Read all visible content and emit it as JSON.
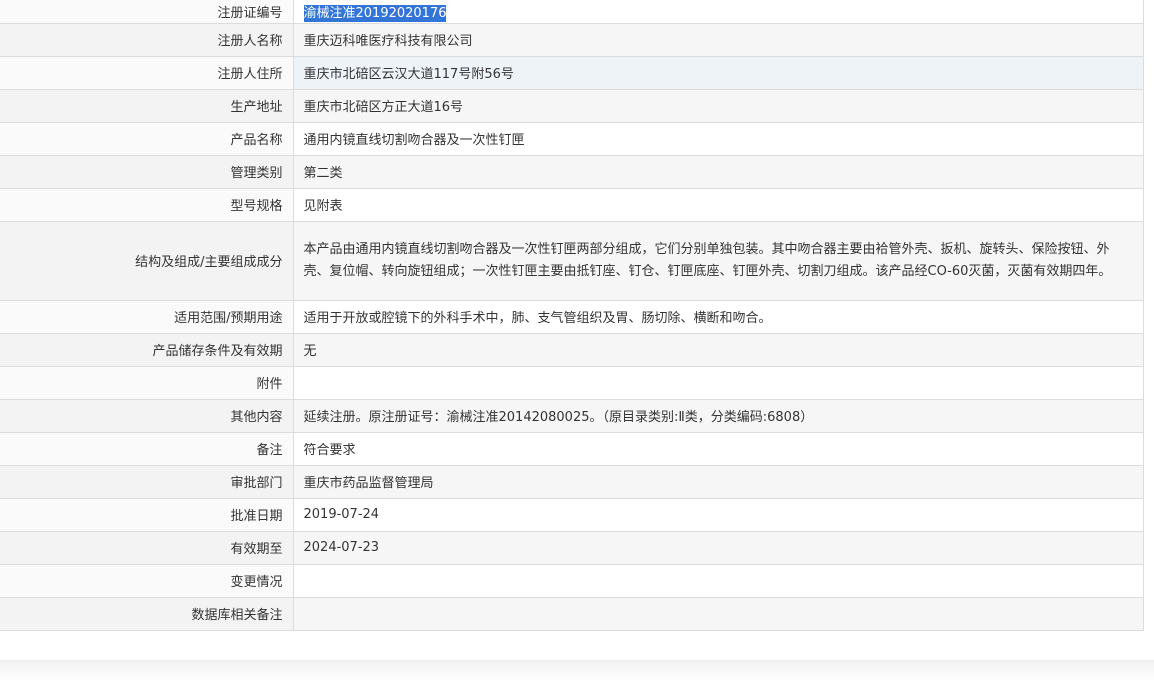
{
  "rows": [
    {
      "label": "注册证编号",
      "value": "渝械注准20192020176"
    },
    {
      "label": "注册人名称",
      "value": "重庆迈科唯医疗科技有限公司"
    },
    {
      "label": "注册人住所",
      "value": "重庆市北碚区云汉大道117号附56号"
    },
    {
      "label": "生产地址",
      "value": "重庆市北碚区方正大道16号"
    },
    {
      "label": "产品名称",
      "value": "通用内镜直线切割吻合器及一次性钉匣"
    },
    {
      "label": "管理类别",
      "value": "第二类"
    },
    {
      "label": "型号规格",
      "value": "见附表"
    },
    {
      "label": "结构及组成/主要组成成分",
      "value": "本产品由通用内镜直线切割吻合器及一次性钉匣两部分组成，它们分别单独包装。其中吻合器主要由袷管外壳、扳机、旋转头、保险按钮、外壳、复位帽、转向旋钮组成；一次性钉匣主要由抵钉座、钉仓、钉匣底座、钉匣外壳、切割刀组成。该产品经CO-60灭菌，灭菌有效期四年。"
    },
    {
      "label": "适用范围/预期用途",
      "value": "适用于开放或腔镜下的外科手术中，肺、支气管组织及胃、肠切除、横断和吻合。"
    },
    {
      "label": "产品储存条件及有效期",
      "value": "无"
    },
    {
      "label": "附件",
      "value": ""
    },
    {
      "label": "其他内容",
      "value": "延续注册。原注册证号：渝械注准20142080025。（原目录类别:Ⅱ类，分类编码:6808）"
    },
    {
      "label": "备注",
      "value": "符合要求"
    },
    {
      "label": "审批部门",
      "value": "重庆市药品监督管理局"
    },
    {
      "label": "批准日期",
      "value": "2019-07-24"
    },
    {
      "label": "有效期至",
      "value": "2024-07-23"
    },
    {
      "label": "变更情况",
      "value": ""
    },
    {
      "label": "数据库相关备注",
      "value": ""
    }
  ],
  "colors": {
    "selection": "#3375d6",
    "border": "#dcdcdc"
  }
}
